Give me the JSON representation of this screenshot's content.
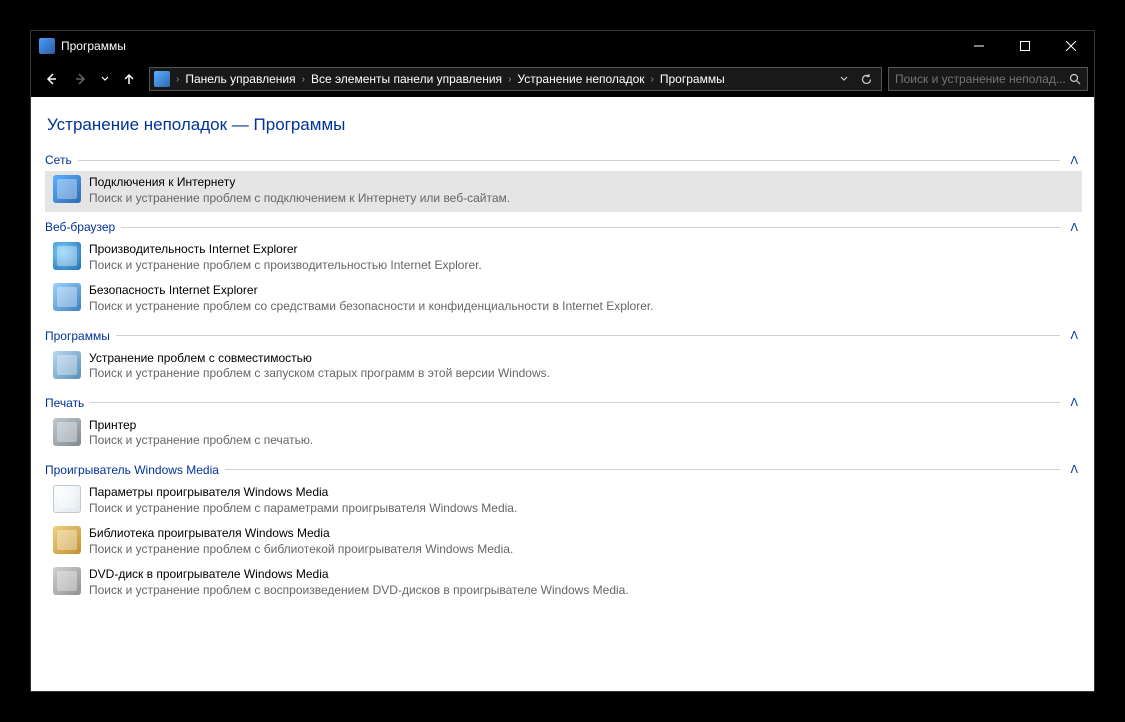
{
  "window": {
    "title": "Программы"
  },
  "breadcrumb": {
    "items": [
      "Панель управления",
      "Все элементы панели управления",
      "Устранение неполадок",
      "Программы"
    ]
  },
  "search": {
    "placeholder": "Поиск и устранение неполад..."
  },
  "page": {
    "title": "Устранение неполадок — Программы"
  },
  "sections": {
    "network": {
      "title": "Сеть",
      "items": [
        {
          "title": "Подключения к Интернету",
          "desc": "Поиск и устранение проблем с подключением к Интернету или веб-сайтам."
        }
      ]
    },
    "browser": {
      "title": "Веб-браузер",
      "items": [
        {
          "title": "Производительность Internet Explorer",
          "desc": "Поиск и устранение проблем с производительностью Internet Explorer."
        },
        {
          "title": "Безопасность Internet Explorer",
          "desc": "Поиск и устранение проблем со средствами безопасности и конфиденциальности в Internet Explorer."
        }
      ]
    },
    "programs": {
      "title": "Программы",
      "items": [
        {
          "title": "Устранение проблем с совместимостью",
          "desc": "Поиск и устранение проблем с запуском старых программ в этой версии Windows."
        }
      ]
    },
    "print": {
      "title": "Печать",
      "items": [
        {
          "title": "Принтер",
          "desc": "Поиск и устранение проблем с печатью."
        }
      ]
    },
    "wmp": {
      "title": "Проигрыватель Windows Media",
      "items": [
        {
          "title": "Параметры проигрывателя Windows Media",
          "desc": "Поиск и устранение проблем с параметрами проигрывателя Windows Media."
        },
        {
          "title": "Библиотека проигрывателя Windows Media",
          "desc": "Поиск и устранение проблем с библиотекой проигрывателя Windows Media."
        },
        {
          "title": "DVD-диск в проигрывателе Windows Media",
          "desc": "Поиск и устранение проблем с воспроизведением DVD-дисков в проигрывателе Windows Media."
        }
      ]
    }
  }
}
